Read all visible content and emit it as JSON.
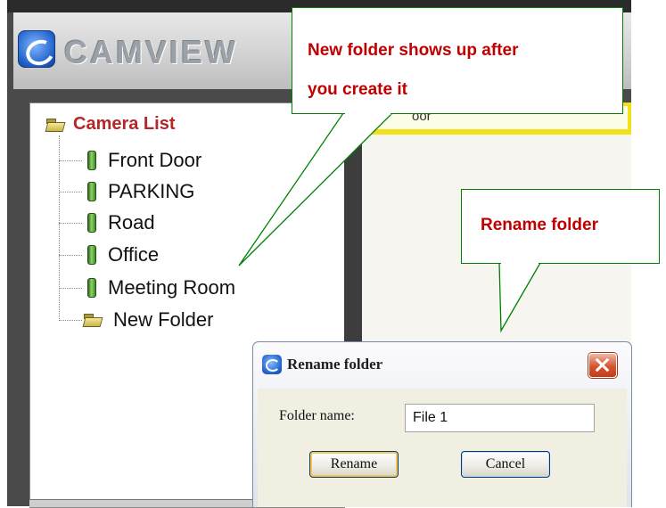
{
  "app": {
    "logo_text": "CAMVIEW"
  },
  "camera_list": {
    "title": "Camera List",
    "items": [
      {
        "label": "Front Door",
        "type": "camera"
      },
      {
        "label": "PARKING",
        "type": "camera"
      },
      {
        "label": "Road",
        "type": "camera"
      },
      {
        "label": "Office",
        "type": "camera"
      },
      {
        "label": "Meeting Room",
        "type": "camera"
      },
      {
        "label": "New Folder",
        "type": "folder"
      }
    ]
  },
  "viewer": {
    "header_text": "oor"
  },
  "callouts": {
    "new_folder_line1": "New folder shows up after",
    "new_folder_line2": "you create it",
    "rename": "Rename folder"
  },
  "dialog": {
    "title": "Rename folder",
    "field_label": "Folder name:",
    "field_value": "File 1",
    "rename_label": "Rename",
    "cancel_label": "Cancel"
  },
  "colors": {
    "callout_text": "#c00000",
    "callout_border": "#008000",
    "tree_root_text": "#b3262a",
    "viewer_bar": "#f2e01a"
  }
}
